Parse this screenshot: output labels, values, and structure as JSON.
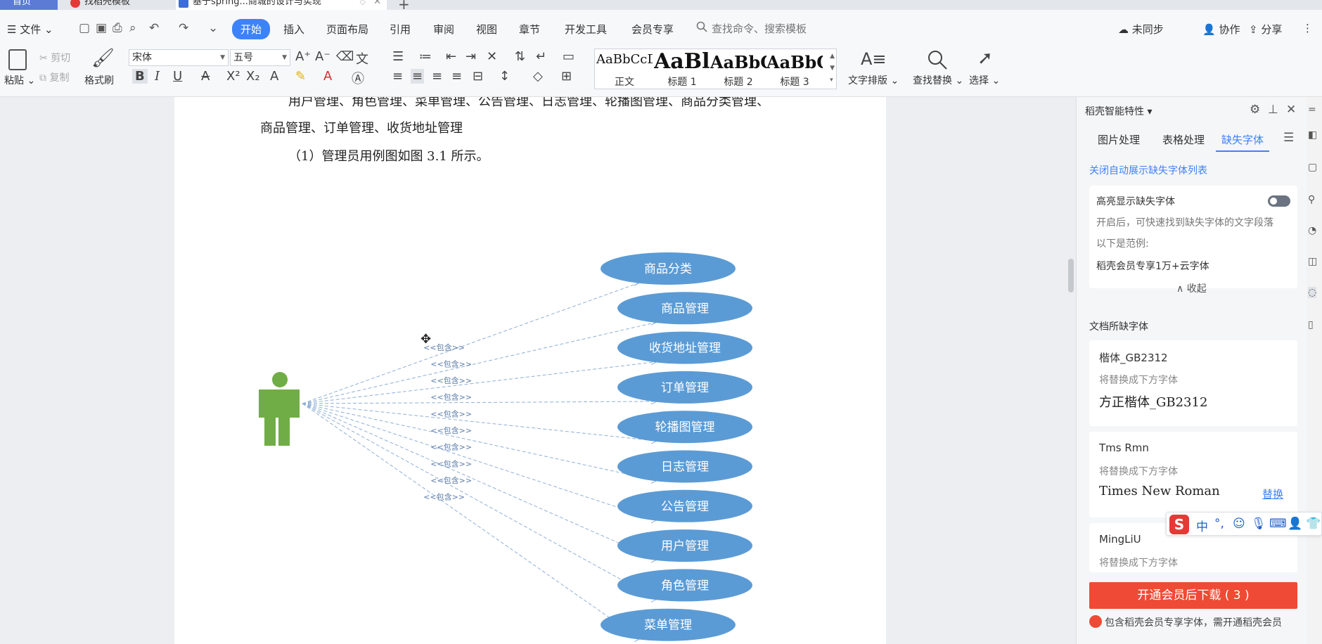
{
  "tabs": [
    {
      "label": "首页"
    },
    {
      "label": "找稻壳模板"
    },
    {
      "label": "基于spring...商城的设计与实现"
    }
  ],
  "menu": {
    "file": "文件",
    "items": [
      "开始",
      "插入",
      "页面布局",
      "引用",
      "审阅",
      "视图",
      "章节",
      "开发工具",
      "会员专享"
    ],
    "active_index": 0,
    "search_placeholder": "查找命令、搜索模板",
    "right_actions": [
      "未同步",
      "协作",
      "分享"
    ]
  },
  "ribbon": {
    "paste": "粘贴",
    "cut": "剪切",
    "copy": "复制",
    "format_painter": "格式刷",
    "font_name": "宋体",
    "font_size": "五号",
    "styles": [
      {
        "preview": "AaBbCcDd",
        "label": "正文"
      },
      {
        "preview": "AaBl",
        "label": "标题 1"
      },
      {
        "preview": "AaBbC",
        "label": "标题 2"
      },
      {
        "preview": "AaBbC",
        "label": "标题 3"
      }
    ],
    "text_layout": "文字排版",
    "find_replace": "查找替换",
    "select": "选择"
  },
  "document": {
    "line1": "用户管理、角色管理、菜单管理、公告管理、日志管理、轮播图管理、商品分类管理、",
    "line2": "商品管理、订单管理、收货地址管理",
    "line3": "（1）管理员用例图如图 3.1 所示。"
  },
  "diagram": {
    "include_label": "<<包含>>",
    "use_cases": [
      "商品分类",
      "商品管理",
      "收货地址管理",
      "订单管理",
      "轮播图管理",
      "日志管理",
      "公告管理",
      "用户管理",
      "角色管理",
      "菜单管理"
    ],
    "ellipse_color": "#5b9bd5",
    "actor_color": "#70ad47"
  },
  "panel": {
    "title": "稻壳智能特性",
    "tabs": [
      "图片处理",
      "表格处理",
      "缺失字体"
    ],
    "active_tab": 2,
    "close_auto_link": "关闭自动展示缺失字体列表",
    "highlight_title": "高亮显示缺失字体",
    "highlight_desc": "开启后，可快速找到缺失字体的文字段落",
    "example_label": "以下是范例:",
    "example_text": "稻壳会员专享1万+云字体",
    "collapse": "收起",
    "missing_section": "文档所缺字体",
    "fonts": [
      {
        "name": "楷体_GB2312",
        "hint": "将替换成下方字体",
        "replacement": "方正楷体_GB2312",
        "action": ""
      },
      {
        "name": "Tms Rmn",
        "hint": "将替换成下方字体",
        "replacement": "Times New Roman",
        "action": "替换"
      },
      {
        "name": "MingLiU",
        "hint": "将替换成下方字体",
        "replacement": "",
        "action": ""
      }
    ],
    "download_button": "开通会员后下载 ( 3 )",
    "note": "包含稻壳会员专享字体，需开通稻壳会员"
  },
  "ime": {
    "logo": "S",
    "mode": "中",
    "punct": "°,"
  }
}
